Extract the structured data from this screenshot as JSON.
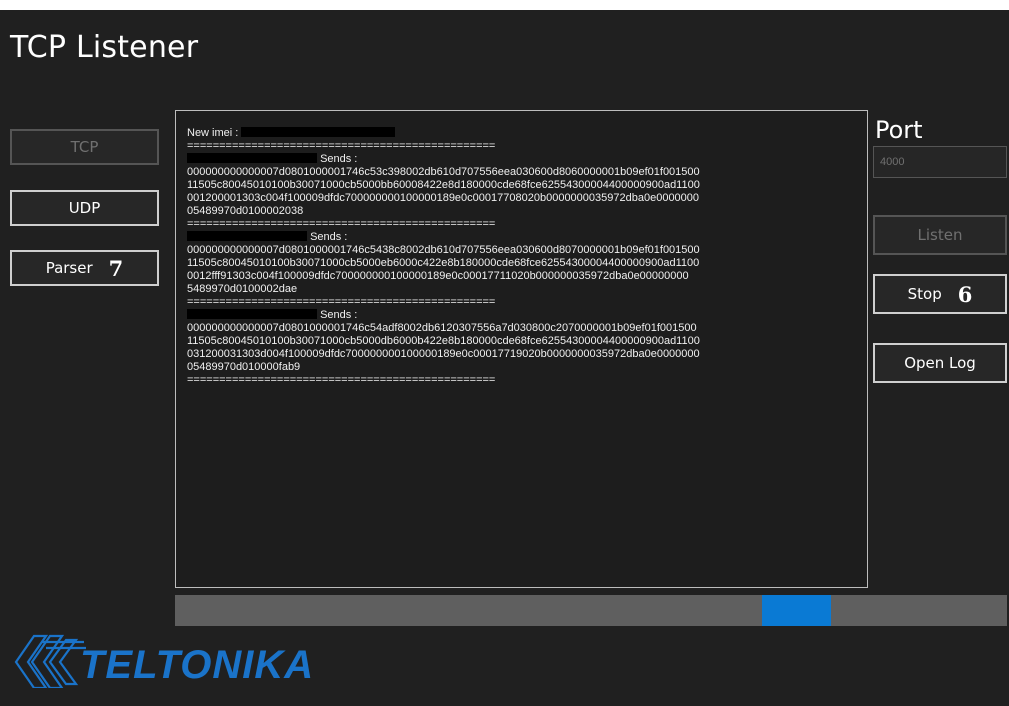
{
  "window": {
    "title": "TCP Listener"
  },
  "sidebar": {
    "tcp_label": "TCP",
    "udp_label": "UDP",
    "parser_label": "Parser",
    "parser_badge": "7"
  },
  "log": {
    "new_imei_label": "New imei :",
    "separator": "================================================",
    "sends_label": "Sends :",
    "blocks": [
      {
        "lines": [
          "000000000000007d0801000001746c53c398002db610d707556eea030600d8060000001b09ef01f001500",
          "11505c80045010100b30071000cb5000bb60008422e8d180000cde68fce62554300004400000900ad1100",
          "001200001303c004f100009dfdc700000000100000189e0c00017708020b0000000035972dba0e0000000",
          "05489970d0100002038"
        ]
      },
      {
        "lines": [
          "000000000000007d0801000001746c5438c8002db610d707556eea030600d8070000001b09ef01f001500",
          "11505c80045010100b30071000cb5000eb6000c422e8b180000cde68fce62554300004400000900ad1100",
          "0012fff91303c004f100009dfdc700000000100000189e0c00017711020b000000035972dba0e00000000",
          "5489970d0100002dae"
        ]
      },
      {
        "lines": [
          "000000000000007d0801000001746c54adf8002db6120307556a7d030800c2070000001b09ef01f001500",
          "11505c80045010100b30071000cb5000db6000b422e8b180000cde68fce62554300004400000900ad1100",
          "031200031303d004f100009dfdc700000000100000189e0c00017719020b0000000035972dba0e0000000",
          "05489970d010000fab9"
        ]
      }
    ]
  },
  "port": {
    "label": "Port",
    "value": "4000"
  },
  "buttons": {
    "listen_label": "Listen",
    "stop_label": "Stop",
    "stop_badge": "6",
    "open_log_label": "Open Log"
  },
  "progress": {
    "indicator_start": 0.705,
    "indicator_end": 0.788,
    "track_color": "#5f5f5f",
    "indicator_color": "#0a7ad4"
  },
  "brand": {
    "logo_text": "TELTONIKA",
    "logo_color": "#1a73c9"
  }
}
